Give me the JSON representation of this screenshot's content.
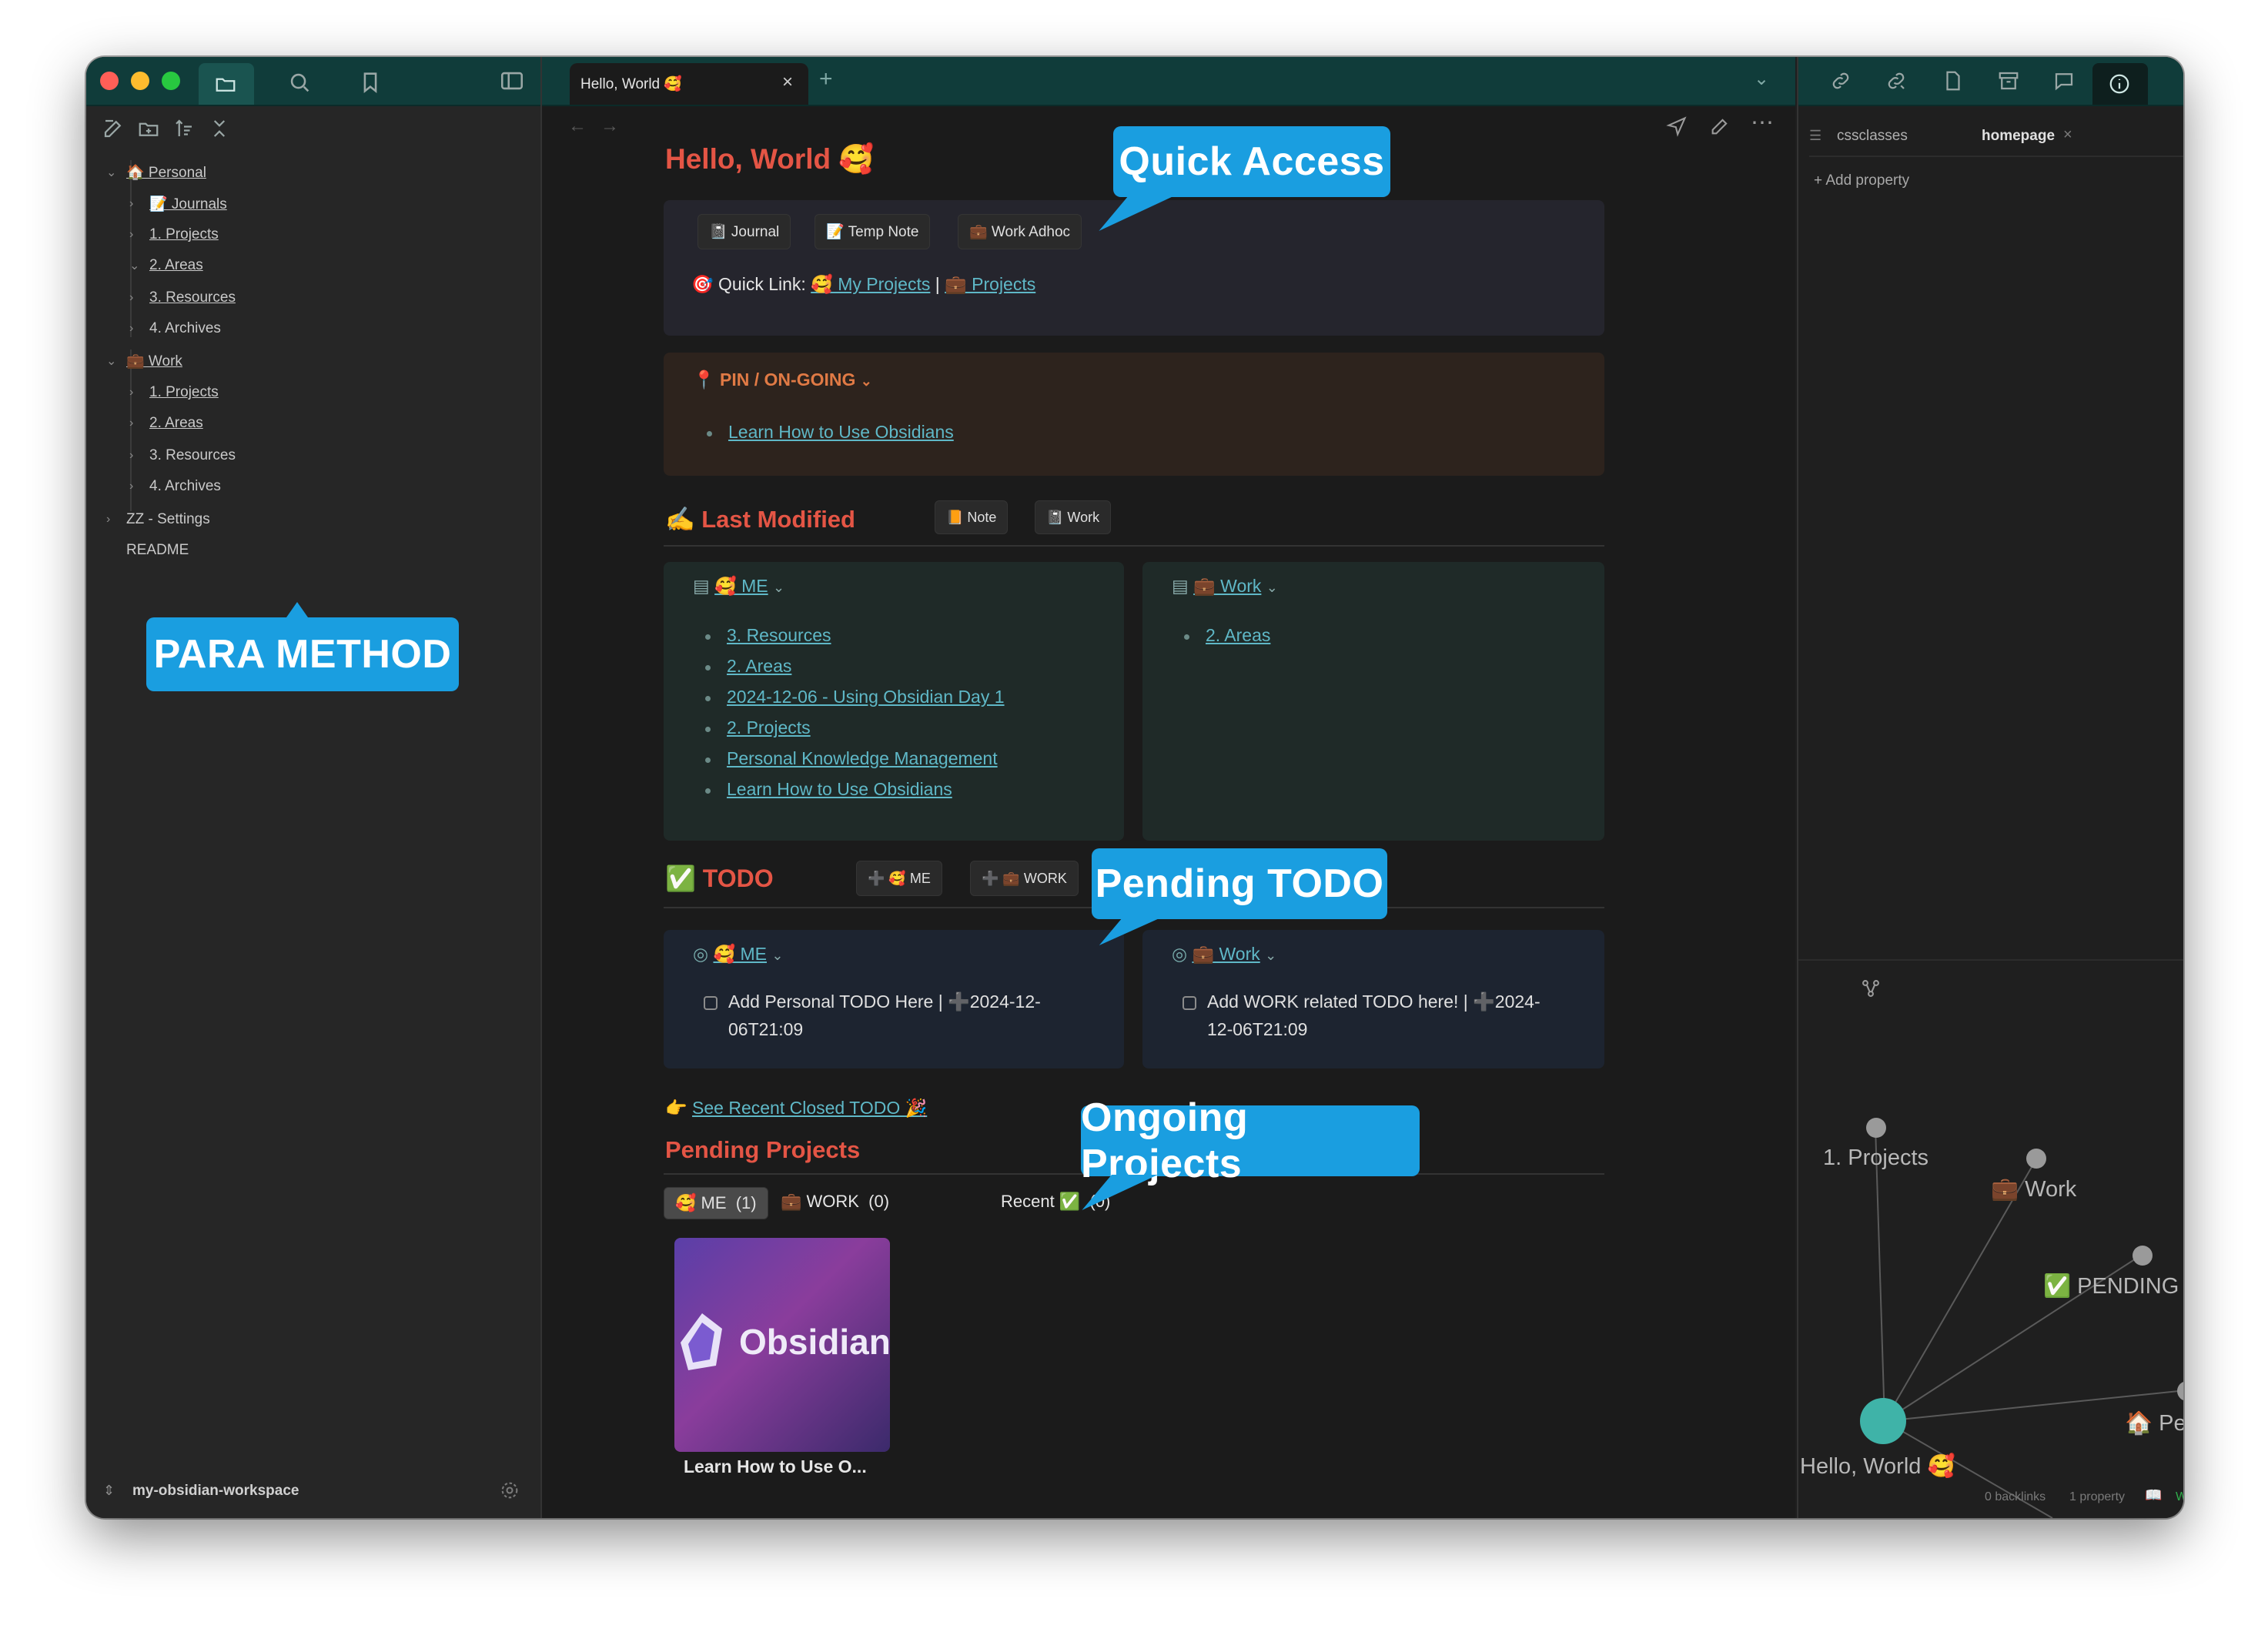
{
  "window": {
    "tab_title": "Hello, World 🥰",
    "new_tab": "+"
  },
  "sidebar": {
    "items": [
      {
        "label": "🏠 Personal",
        "linked": true
      },
      {
        "label": "📝 Journals",
        "linked": true
      },
      {
        "label": "1. Projects",
        "linked": true
      },
      {
        "label": "2. Areas",
        "linked": true
      },
      {
        "label": "3. Resources",
        "linked": true
      },
      {
        "label": "4. Archives",
        "linked": false
      },
      {
        "label": "💼 Work",
        "linked": true
      },
      {
        "label": "1. Projects",
        "linked": true
      },
      {
        "label": "2. Areas",
        "linked": true
      },
      {
        "label": "3. Resources",
        "linked": false
      },
      {
        "label": "4. Archives",
        "linked": false
      },
      {
        "label": "ZZ - Settings",
        "linked": false
      },
      {
        "label": "README",
        "linked": false
      }
    ],
    "vault_name": "my-obsidian-workspace"
  },
  "callouts": {
    "para": "PARA METHOD",
    "quick": "Quick Access",
    "todo": "Pending TODO",
    "ongoing": "Ongoing Projects"
  },
  "note": {
    "title": "Hello, World 🥰",
    "quick_buttons": [
      "📓 Journal",
      "📝 Temp Note",
      "💼 Work Adhoc"
    ],
    "quick_link_label": "🎯 Quick Link:",
    "quick_link_1": "🥰 My Projects",
    "quick_link_sep": "|",
    "quick_link_2": "💼 Projects",
    "pin": {
      "header": "📍 PIN / ON-GOING",
      "items": [
        "Learn How to Use Obsidians"
      ]
    },
    "last_modified": {
      "title": "✍️ Last Modified",
      "btn_note": "📙 Note",
      "btn_work": "📓 Work",
      "me_header": "🥰 ME",
      "me_items": [
        "3. Resources",
        "2. Areas",
        "2024-12-06 - Using Obsidian Day 1",
        "2. Projects",
        "Personal Knowledge Management",
        "Learn How to Use Obsidians"
      ],
      "work_header": "💼 Work",
      "work_items": [
        "2. Areas"
      ]
    },
    "todo": {
      "title": "✅ TODO",
      "btn_me": "➕ 🥰 ME",
      "btn_work": "➕ 💼 WORK",
      "me_header": "🥰 ME",
      "me_task_line1": "Add Personal TODO Here | ➕2024-12-",
      "me_task_line2": "06T21:09",
      "work_header": "💼 Work",
      "work_task_line1": "Add WORK related TODO here! | ➕2024-",
      "work_task_line2": "12-06T21:09"
    },
    "closed_todo": {
      "prefix": "👉",
      "link": "See Recent Closed TODO 🎉"
    },
    "pending_projects": {
      "title": "Pending Projects",
      "tabs": [
        "🥰 ME  (1)",
        "💼 WORK  (0)",
        "Recent ✅  (0)"
      ],
      "card_image_text": "Obsidian",
      "card_caption": "Learn How to Use O..."
    }
  },
  "right_panel": {
    "prop_cssclasses": "cssclasses",
    "prop_value": "homepage",
    "add_property": "+ Add property",
    "graph_nodes": [
      "1. Projects",
      "💼 Work",
      "✅ PENDING TODO",
      "🏠 Personal",
      "Hello, World 🥰"
    ],
    "status_backlinks": "0 backlinks",
    "status_props": "1 property",
    "status_whisper": "Whisper Idle"
  },
  "colors": {
    "tabbar": "#103c3a",
    "accent_link": "#5fb8c7",
    "heading_red": "#e45545",
    "callout_blue": "#1a9ee0",
    "graph_main_node": "#3fb3a8"
  }
}
